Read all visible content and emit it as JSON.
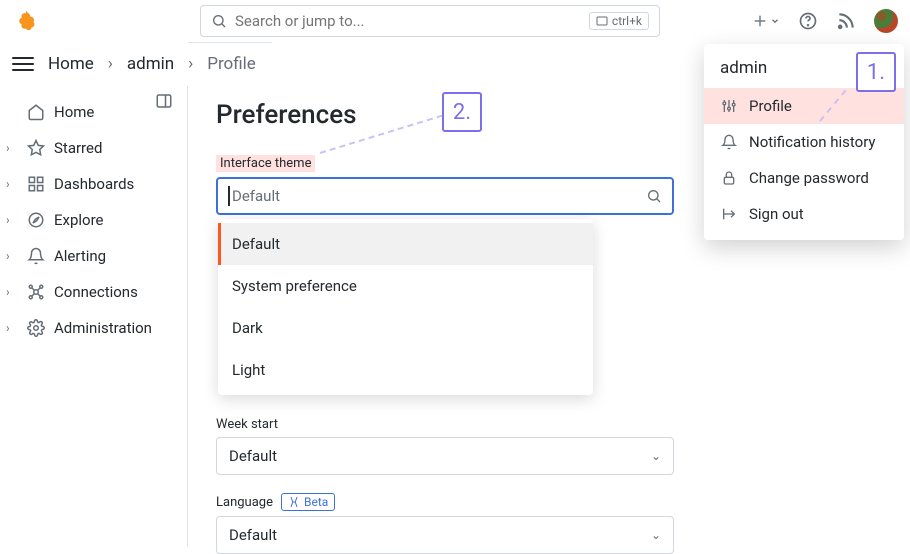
{
  "search": {
    "placeholder": "Search or jump to...",
    "shortcut": "ctrl+k"
  },
  "breadcrumbs": {
    "home": "Home",
    "admin": "admin",
    "current": "Profile"
  },
  "sidebar": {
    "items": [
      {
        "label": "Home"
      },
      {
        "label": "Starred"
      },
      {
        "label": "Dashboards"
      },
      {
        "label": "Explore"
      },
      {
        "label": "Alerting"
      },
      {
        "label": "Connections"
      },
      {
        "label": "Administration"
      }
    ]
  },
  "page": {
    "title": "Preferences"
  },
  "theme": {
    "label": "Interface theme",
    "value": "Default",
    "options": [
      "Default",
      "System preference",
      "Dark",
      "Light"
    ]
  },
  "weekstart": {
    "label": "Week start",
    "value": "Default"
  },
  "language": {
    "label": "Language",
    "badge": "Beta",
    "value": "Default"
  },
  "usermenu": {
    "name": "admin",
    "items": [
      {
        "label": "Profile"
      },
      {
        "label": "Notification history"
      },
      {
        "label": "Change password"
      },
      {
        "label": "Sign out"
      }
    ]
  },
  "annotations": {
    "one": "1.",
    "two": "2."
  }
}
